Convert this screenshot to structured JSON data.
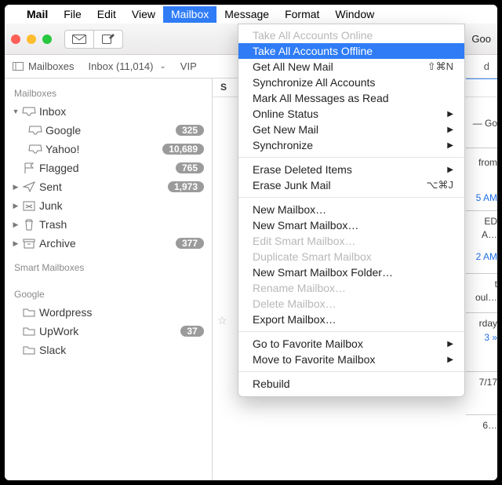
{
  "menubar": {
    "apple": "",
    "items": [
      "Mail",
      "File",
      "Edit",
      "View",
      "Mailbox",
      "Message",
      "Format",
      "Window"
    ],
    "open_index": 4
  },
  "toolbar": {
    "right_hint": "Goo"
  },
  "favorites": {
    "mailboxes": "Mailboxes",
    "inbox": "Inbox (11,014)",
    "vips": "VIP",
    "right_hint": "d"
  },
  "sidebar": {
    "section1": "Mailboxes",
    "inbox": {
      "label": "Inbox"
    },
    "google": {
      "label": "Google",
      "count": "325"
    },
    "yahoo": {
      "label": "Yahoo!",
      "count": "10,689"
    },
    "flagged": {
      "label": "Flagged",
      "count": "765"
    },
    "sent": {
      "label": "Sent",
      "count": "1,973"
    },
    "junk": {
      "label": "Junk"
    },
    "trash": {
      "label": "Trash"
    },
    "archive": {
      "label": "Archive",
      "count": "377"
    },
    "section2": "Smart Mailboxes",
    "section3": "Google",
    "wordpress": {
      "label": "Wordpress"
    },
    "upwork": {
      "label": "UpWork",
      "count": "37"
    },
    "slack": {
      "label": "Slack"
    }
  },
  "content": {
    "col": "S",
    "edge": {
      "l1": "— Go",
      "l2": "from",
      "l3": "5 AM",
      "l4": "ED",
      "l5": "A…",
      "l6": "2 AM",
      "l7": "t",
      "l8": "oul…",
      "l9": "rday",
      "l10": "3 »",
      "l11": "7/17",
      "l12": "6…"
    }
  },
  "menu": {
    "items": [
      {
        "label": "Take All Accounts Online",
        "state": "disabled"
      },
      {
        "label": "Take All Accounts Offline",
        "state": "highlight"
      },
      {
        "label": "Get All New Mail",
        "shortcut": "⇧⌘N"
      },
      {
        "label": "Synchronize All Accounts"
      },
      {
        "label": "Mark All Messages as Read"
      },
      {
        "label": "Online Status",
        "submenu": true
      },
      {
        "label": "Get New Mail",
        "submenu": true
      },
      {
        "label": "Synchronize",
        "submenu": true
      },
      {
        "sep": true
      },
      {
        "label": "Erase Deleted Items",
        "submenu": true
      },
      {
        "label": "Erase Junk Mail",
        "shortcut": "⌥⌘J"
      },
      {
        "sep": true
      },
      {
        "label": "New Mailbox…"
      },
      {
        "label": "New Smart Mailbox…"
      },
      {
        "label": "Edit Smart Mailbox…",
        "state": "disabled"
      },
      {
        "label": "Duplicate Smart Mailbox",
        "state": "disabled"
      },
      {
        "label": "New Smart Mailbox Folder…"
      },
      {
        "label": "Rename Mailbox…",
        "state": "disabled"
      },
      {
        "label": "Delete Mailbox…",
        "state": "disabled"
      },
      {
        "label": "Export Mailbox…"
      },
      {
        "sep": true
      },
      {
        "label": "Go to Favorite Mailbox",
        "submenu": true
      },
      {
        "label": "Move to Favorite Mailbox",
        "submenu": true
      },
      {
        "sep": true
      },
      {
        "label": "Rebuild"
      }
    ]
  }
}
